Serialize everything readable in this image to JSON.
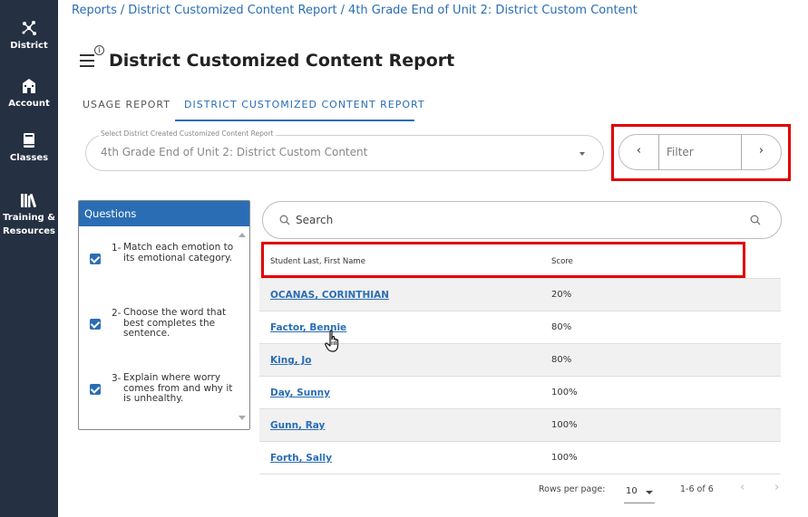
{
  "sidebar": {
    "items": [
      {
        "label": "District",
        "icon": "network-icon"
      },
      {
        "label": "Account",
        "icon": "building-icon"
      },
      {
        "label": "Classes",
        "icon": "book-icon"
      },
      {
        "label": "Training &",
        "label2": "Resources",
        "icon": "library-icon"
      }
    ]
  },
  "breadcrumb": {
    "items": [
      "Reports",
      "District Customized Content Report",
      "4th Grade End of Unit 2: District Custom Content"
    ],
    "separator": "/"
  },
  "header": {
    "info_glyph": "i",
    "title": "District Customized Content Report"
  },
  "tabs": [
    {
      "label": "USAGE REPORT",
      "active": false
    },
    {
      "label": "DISTRICT CUSTOMIZED CONTENT REPORT",
      "active": true
    }
  ],
  "content_select": {
    "label": "Select District Created Customized Content Report",
    "value": "4th Grade End of Unit 2: District Custom Content"
  },
  "filter": {
    "placeholder": "Filter",
    "prev_glyph": "‹",
    "next_glyph": "›"
  },
  "questions": {
    "title": "Questions",
    "items": [
      {
        "number": "1-",
        "text": "Match each emotion to its emotional category.",
        "checked": true
      },
      {
        "number": "2-",
        "text": "Choose the word that best completes the sentence.",
        "checked": true
      },
      {
        "number": "3-",
        "text": "Explain where worry comes from and why it is unhealthy.",
        "checked": true
      }
    ]
  },
  "search": {
    "placeholder": "Search"
  },
  "table": {
    "columns": [
      "Student Last, First Name",
      "Score"
    ],
    "rows": [
      {
        "name": "OCANAS, CORINTHIAN",
        "score": "20%"
      },
      {
        "name": "Factor, Bennie",
        "score": "80%"
      },
      {
        "name": "King, Jo",
        "score": "80%"
      },
      {
        "name": "Day, Sunny",
        "score": "100%"
      },
      {
        "name": "Gunn, Ray",
        "score": "100%"
      },
      {
        "name": "Forth, Sally",
        "score": "100%"
      }
    ]
  },
  "pagination": {
    "rows_per_page_label": "Rows per page:",
    "rows_per_page_value": "10",
    "range": "1-6 of 6",
    "prev_glyph": "‹",
    "next_glyph": "›"
  },
  "colors": {
    "sidebar_bg": "#253142",
    "accent": "#2a6db5",
    "highlight_border": "#e00000"
  }
}
